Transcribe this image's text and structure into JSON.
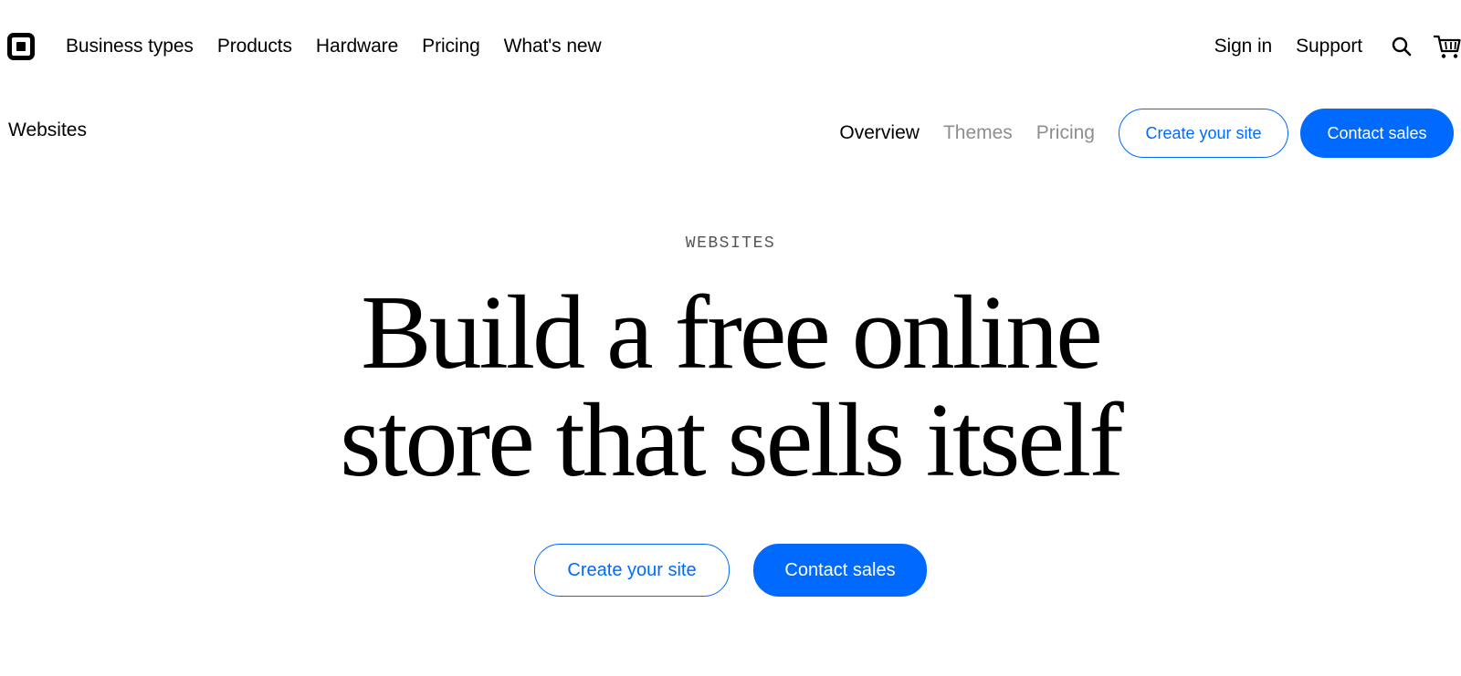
{
  "header": {
    "nav_left": [
      "Business types",
      "Products",
      "Hardware",
      "Pricing",
      "What's new"
    ],
    "sign_in": "Sign in",
    "support": "Support",
    "icons": {
      "logo": "square-logo-icon",
      "search": "search-icon",
      "cart": "cart-icon"
    }
  },
  "subnav": {
    "title": "Websites",
    "tabs": [
      {
        "label": "Overview",
        "active": true
      },
      {
        "label": "Themes",
        "active": false
      },
      {
        "label": "Pricing",
        "active": false
      }
    ],
    "create_label": "Create your site",
    "contact_label": "Contact sales"
  },
  "hero": {
    "eyebrow": "WEBSITES",
    "headline_line1": "Build a free online",
    "headline_line2": "store that sells itself",
    "create_label": "Create your site",
    "contact_label": "Contact sales"
  },
  "colors": {
    "accent": "#006aff",
    "text": "#000000",
    "muted_tab": "#8e8e8e",
    "eyebrow": "#555555",
    "background": "#ffffff"
  }
}
